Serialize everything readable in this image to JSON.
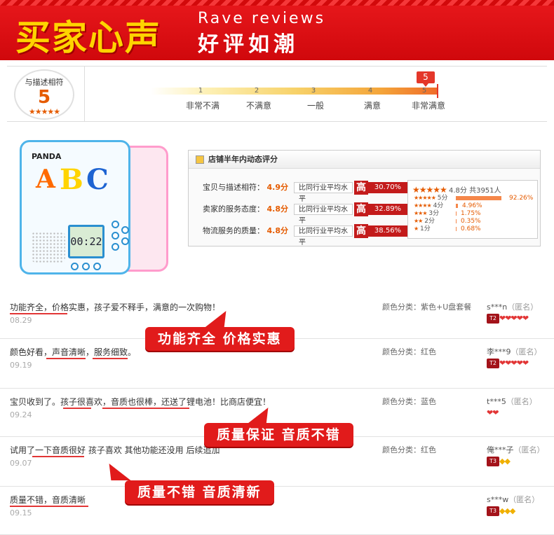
{
  "banner": {
    "title_cn": "买家心声",
    "title_en": "Rave reviews",
    "subtitle_cn": "好评如潮"
  },
  "rating": {
    "label": "与描述相符",
    "score": "5",
    "stars": "★★★★★",
    "marker": "5",
    "ticks": [
      "1",
      "2",
      "3",
      "4",
      "5"
    ],
    "levels": [
      "非常不满",
      "不满意",
      "一般",
      "满意",
      "非常满意"
    ]
  },
  "product": {
    "brand": "PANDA",
    "letters": [
      "A",
      "B",
      "C"
    ],
    "lcd_time": "00:22"
  },
  "store": {
    "header": "店铺半年内动态评分",
    "compare_label": "比同行业平均水平",
    "high": "高",
    "rows": [
      {
        "label": "宝贝与描述相符：",
        "score": "4.9分",
        "pct": "30.70%"
      },
      {
        "label": "卖家的服务态度：",
        "score": "4.8分",
        "pct": "32.89%"
      },
      {
        "label": "物流服务的质量：",
        "score": "4.8分",
        "pct": "38.56%"
      }
    ],
    "summary_stars": "★★★★★",
    "summary_avg": "4.8分",
    "summary_count": "共3951人",
    "distribution": [
      {
        "label": "5分",
        "pct": "92.26%",
        "fraction": 0.9226
      },
      {
        "label": "4分",
        "pct": "4.96%",
        "fraction": 0.0496
      },
      {
        "label": "3分",
        "pct": "1.75%",
        "fraction": 0.0175
      },
      {
        "label": "2分",
        "pct": "0.35%",
        "fraction": 0.0035
      },
      {
        "label": "1分",
        "pct": "0.68%",
        "fraction": 0.0068
      }
    ],
    "dist_stars": [
      "★★★★★",
      "★★★★",
      "★★★",
      "★★",
      "★"
    ]
  },
  "reviews": [
    {
      "text": "功能齐全，价格实惠，孩子爱不释手，满意的一次购物！",
      "date": "08.29",
      "color": "颜色分类：紫色+U盘套餐",
      "user": "s***n",
      "anon": "（匿名）",
      "level": "T2",
      "gems": "❤❤❤❤❤",
      "gold": false
    },
    {
      "text": "颜色好看，声音清晰，服务细致。",
      "date": "09.19",
      "color": "颜色分类：红色",
      "user": "李***9",
      "anon": "（匿名）",
      "level": "T2",
      "gems": "❤❤❤❤❤",
      "gold": false
    },
    {
      "text": "宝贝收到了。孩子很喜欢，音质也很棒，还送了锂电池！比商店便宜！",
      "date": "09.24",
      "color": "颜色分类：蓝色",
      "user": "t***5",
      "anon": "（匿名）",
      "level": "",
      "gems": "❤❤",
      "gold": false
    },
    {
      "text": "试用了一下音质很好 孩子喜欢 其他功能还没用 后续追加",
      "date": "09.07",
      "color": "颜色分类：红色",
      "user": "俺***子",
      "anon": "（匿名）",
      "level": "T3",
      "gems": "◆◆",
      "gold": true
    },
    {
      "text": "质量不错，音质清晰",
      "date": "09.15",
      "color": "",
      "user": "s***w",
      "anon": "（匿名）",
      "level": "T3",
      "gems": "◆◆◆",
      "gold": true
    }
  ],
  "callouts": [
    "功能齐全 价格实惠",
    "质量保证 音质不错",
    "质量不错 音质清新"
  ],
  "colors": {
    "brand_red": "#e11b1b",
    "accent_orange": "#e55b00",
    "banner_yellow": "#ffd400"
  }
}
